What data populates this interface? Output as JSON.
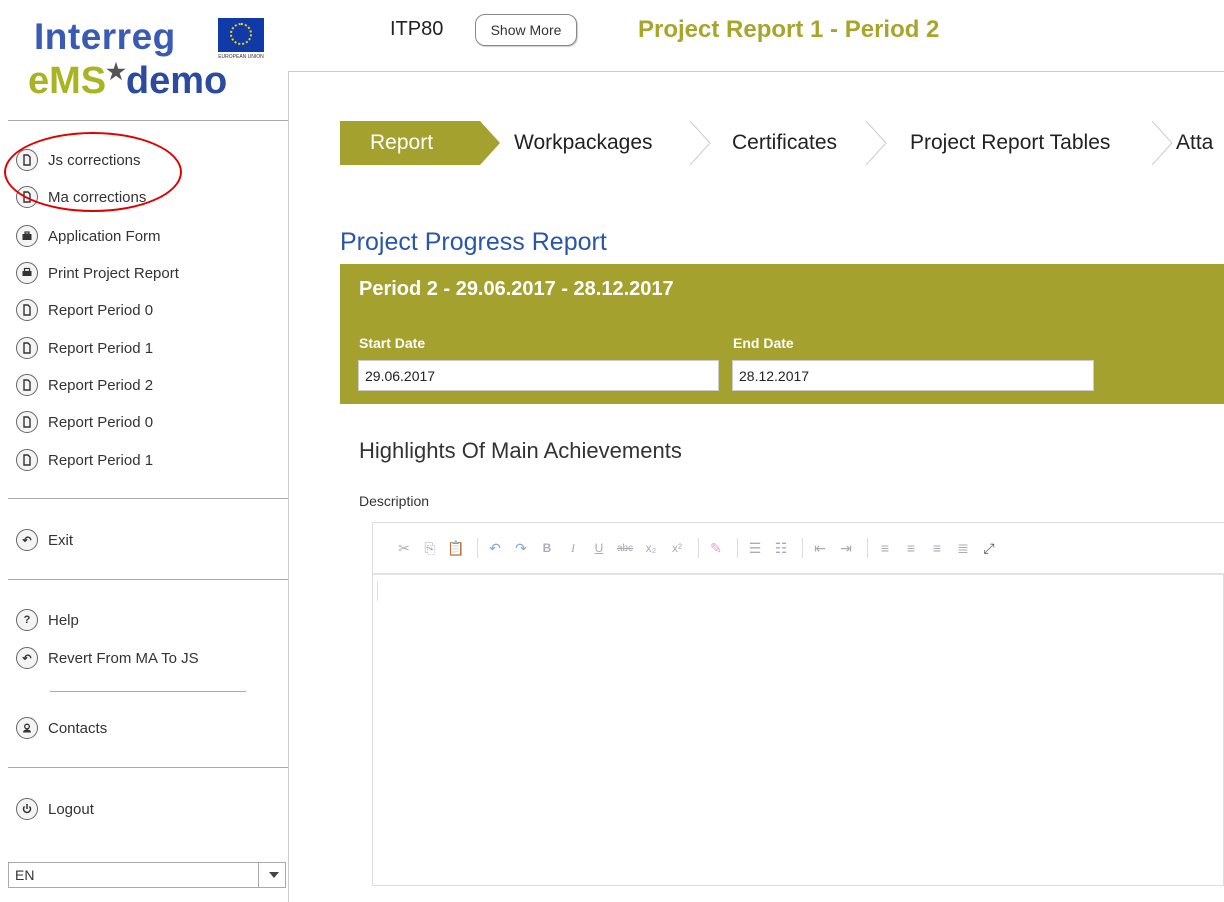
{
  "logo": {
    "line1": "Interreg",
    "eu_text": "EUROPEAN UNION",
    "ems": "eMS",
    "demo": "demo"
  },
  "sidebar": {
    "items": [
      {
        "label": "Js corrections",
        "icon": "document-icon"
      },
      {
        "label": "Ma corrections",
        "icon": "document-icon"
      },
      {
        "label": "Application Form",
        "icon": "briefcase-icon"
      },
      {
        "label": "Print Project Report",
        "icon": "printer-icon"
      },
      {
        "label": "Report Period 0",
        "icon": "document-icon"
      },
      {
        "label": "Report Period 1",
        "icon": "document-icon"
      },
      {
        "label": "Report Period 2",
        "icon": "document-icon"
      },
      {
        "label": "Report Period 0",
        "icon": "document-icon"
      },
      {
        "label": "Report Period 1",
        "icon": "document-icon"
      }
    ],
    "exit": "Exit",
    "help": "Help",
    "revert": "Revert From MA To JS",
    "contacts": "Contacts",
    "logout": "Logout",
    "language": "EN"
  },
  "header": {
    "project_code": "ITP80",
    "show_more": "Show More",
    "title": "Project Report 1 - Period 2"
  },
  "tabs": [
    {
      "label": "Report",
      "active": true
    },
    {
      "label": "Workpackages",
      "active": false
    },
    {
      "label": "Certificates",
      "active": false
    },
    {
      "label": "Project Report Tables",
      "active": false
    },
    {
      "label": "Atta",
      "active": false
    }
  ],
  "main": {
    "section_title": "Project Progress Report",
    "period_title": "Period 2 - 29.06.2017 - 28.12.2017",
    "start_date_label": "Start Date",
    "start_date": "29.06.2017",
    "end_date_label": "End Date",
    "end_date": "28.12.2017",
    "highlights_title": "Highlights Of Main Achievements",
    "description_label": "Description"
  },
  "colors": {
    "accent_olive": "#a4a12e",
    "title_blue": "#2a56a8",
    "annotation_red": "#e00000"
  },
  "toolbar_icons": [
    "cut-icon",
    "copy-icon",
    "paste-text-icon",
    "undo-icon",
    "redo-icon",
    "bold-icon",
    "italic-icon",
    "underline-icon",
    "strikethrough-icon",
    "subscript-icon",
    "superscript-icon",
    "remove-format-icon",
    "numbered-list-icon",
    "bulleted-list-icon",
    "outdent-icon",
    "indent-icon",
    "align-left-icon",
    "align-center-icon",
    "align-right-icon",
    "justify-icon",
    "maximize-icon"
  ]
}
